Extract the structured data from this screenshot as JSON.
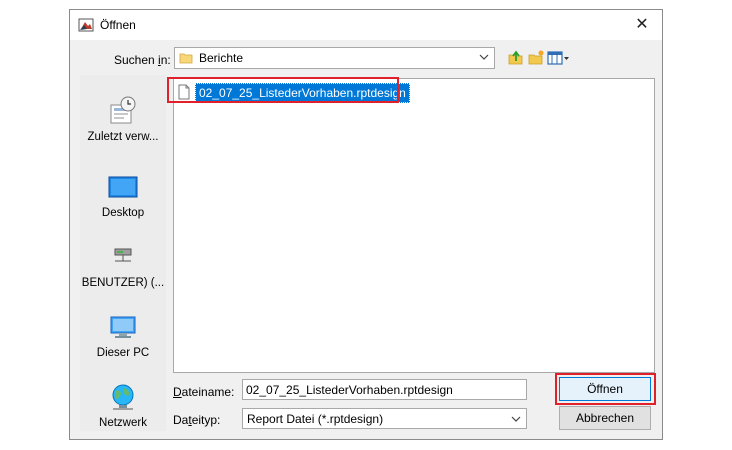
{
  "window": {
    "title": "Öffnen",
    "close_glyph": "✕",
    "icon": "java-cup-icon"
  },
  "lookin": {
    "label_pre": "Suchen ",
    "label_underline": "i",
    "label_post": "n:",
    "value": "Berichte"
  },
  "toolbar": {
    "icons": [
      "folder-up-icon",
      "new-folder-icon",
      "view-menu-icon"
    ]
  },
  "places": [
    {
      "label": "Zuletzt verw...",
      "icon": "recent-icon"
    },
    {
      "label": "Desktop",
      "icon": "desktop-icon"
    },
    {
      "label": "BENUTZER) (...",
      "icon": "network-drive-icon"
    },
    {
      "label": "Dieser PC",
      "icon": "computer-icon"
    },
    {
      "label": "Netzwerk",
      "icon": "globe-icon"
    }
  ],
  "files": [
    {
      "name": "02_07_25_ListederVorhaben.rptdesign",
      "selected": true
    }
  ],
  "filename": {
    "label_underline": "D",
    "label_post": "ateiname:",
    "value": "02_07_25_ListederVorhaben.rptdesign"
  },
  "filetype": {
    "label_pre": "Da",
    "label_underline": "t",
    "label_post": "eityp:",
    "value": "Report Datei (*.rptdesign)"
  },
  "buttons": {
    "open": "Öffnen",
    "cancel": "Abbrechen"
  },
  "colors": {
    "selection": "#0078d7",
    "highlight_border": "#e0202a",
    "dialog_bg": "#f0f0f0"
  }
}
